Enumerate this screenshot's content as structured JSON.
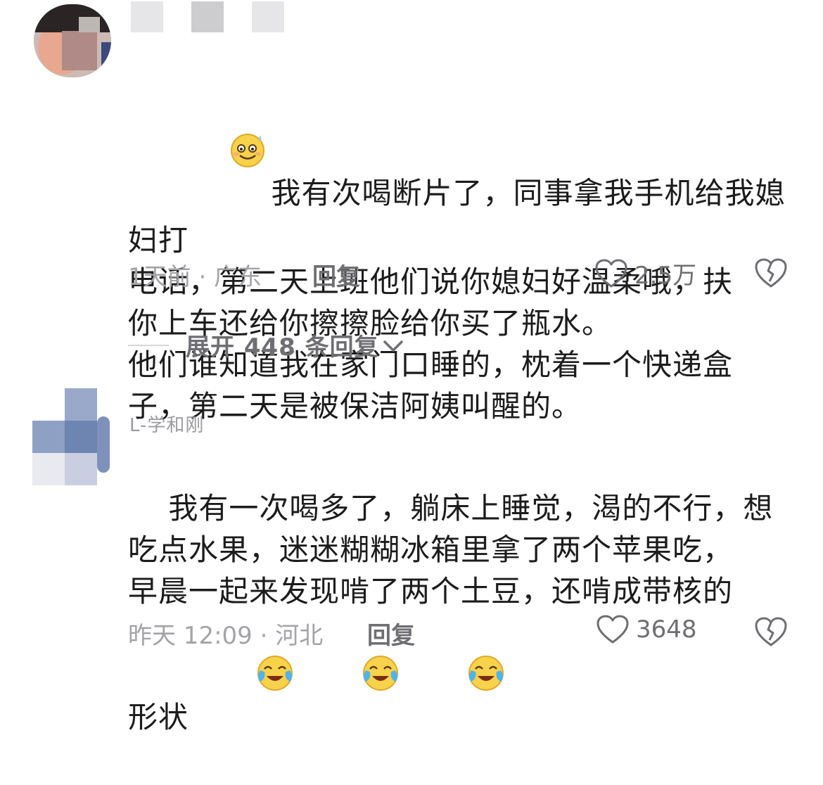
{
  "comments": [
    {
      "username": "",
      "text": "我有次喝断片了，同事拿我手机给我媳妇打\n电话，第二天上班他们说你媳妇好温柔哦，扶\n你上车还给你擦擦脸给你买了瓶水。\n他们谁知道我在家门口睡的，枕着一个快递盒\n子，第二天是被保洁阿姨叫醒的。",
      "time_location": "1天前 · 广东",
      "reply_label": "回复",
      "like_count": "2.5万",
      "expand_label": "展开 448 条回复"
    },
    {
      "username": "L-学和刚",
      "text": "我有一次喝多了，躺床上睡觉，渴的不行，想\n吃点水果，迷迷糊糊冰箱里拿了两个苹果吃，\n早晨一起来发现啃了两个土豆，还啃成带核的\n形状",
      "time_location": "昨天 12:09 · 河北",
      "reply_label": "回复",
      "like_count": "3648"
    }
  ],
  "icons": {
    "emoji_first": "sweat-smile-emoji-icon",
    "emoji_crying": "crying-laugh-emoji-icon",
    "like": "heart-outline-icon",
    "dislike": "broken-heart-icon",
    "expand": "chevron-down-icon"
  },
  "colors": {
    "text": "#1c1c1c",
    "muted": "#a3a3a8",
    "action": "#6e6e73"
  }
}
